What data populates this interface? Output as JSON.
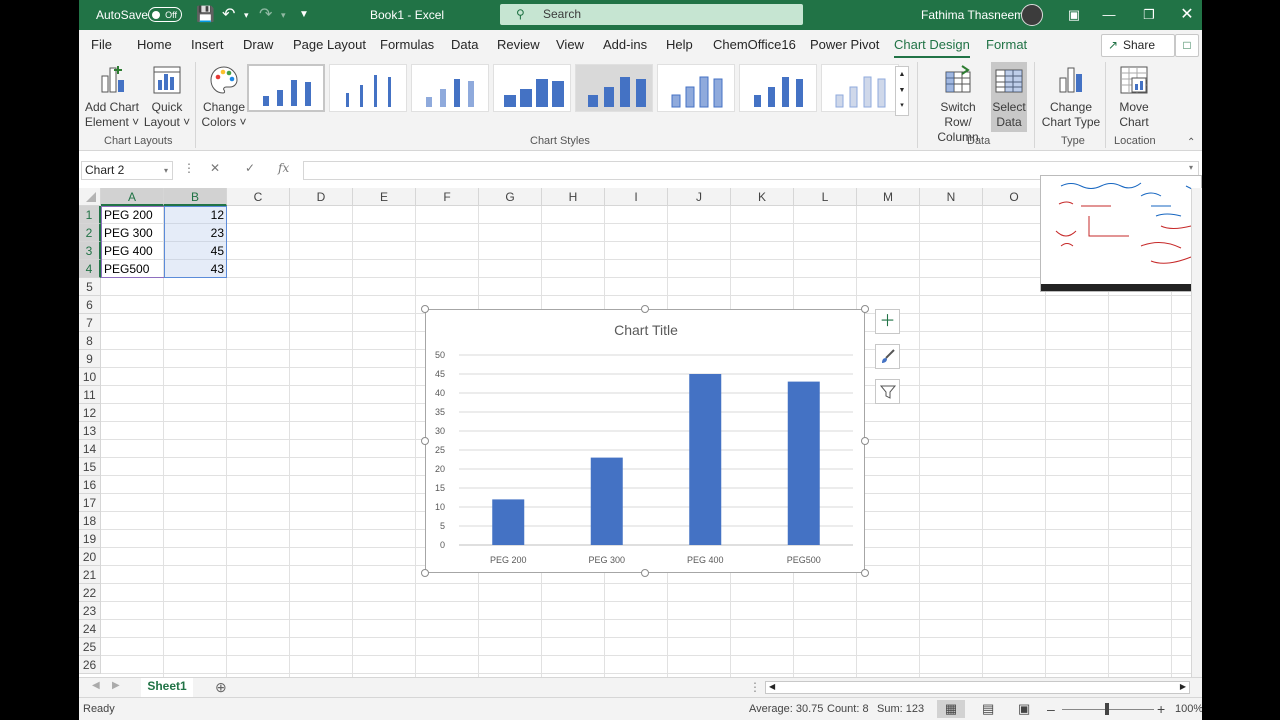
{
  "titlebar": {
    "autosave_label": "AutoSave",
    "autosave_state": "Off",
    "doc_title": "Book1  -  Excel",
    "search_placeholder": "Search",
    "user_name": "Fathima Thasneem"
  },
  "tabs": [
    "File",
    "Home",
    "Insert",
    "Draw",
    "Page Layout",
    "Formulas",
    "Data",
    "Review",
    "View",
    "Add-ins",
    "Help",
    "ChemOffice16",
    "Power Pivot",
    "Chart Design",
    "Format"
  ],
  "active_tab": "Chart Design",
  "share_label": "Share",
  "ribbon": {
    "add_chart_element": [
      "Add Chart",
      "Element ˅"
    ],
    "quick_layout": [
      "Quick",
      "Layout ˅"
    ],
    "change_colors": [
      "Change",
      "Colors ˅"
    ],
    "switch_row_column": [
      "Switch Row/",
      "Column"
    ],
    "select_data": [
      "Select",
      "Data"
    ],
    "change_chart_type": [
      "Change",
      "Chart Type"
    ],
    "move_chart": [
      "Move",
      "Chart"
    ],
    "groups": {
      "chart_layouts": "Chart Layouts",
      "chart_styles": "Chart Styles",
      "data": "Data",
      "type": "Type",
      "location": "Location"
    }
  },
  "formula_bar": {
    "name_box": "Chart 2",
    "cancel": "✕",
    "enter": "✓",
    "fx": "fx",
    "content": ""
  },
  "columns": [
    "A",
    "B",
    "C",
    "D",
    "E",
    "F",
    "G",
    "H",
    "I",
    "J",
    "K",
    "L",
    "M",
    "N",
    "O"
  ],
  "rows": [
    "1",
    "2",
    "3",
    "4",
    "5",
    "6",
    "7",
    "8",
    "9",
    "10",
    "11",
    "12",
    "13",
    "14",
    "15",
    "16",
    "17",
    "18",
    "19",
    "20",
    "21",
    "22",
    "23",
    "24",
    "25",
    "26"
  ],
  "cells": [
    {
      "a": "PEG 200",
      "b": "12"
    },
    {
      "a": "PEG 300",
      "b": "23"
    },
    {
      "a": "PEG 400",
      "b": "45"
    },
    {
      "a": "PEG500",
      "b": "43"
    }
  ],
  "chart_data": {
    "type": "bar",
    "title": "Chart Title",
    "categories": [
      "PEG 200",
      "PEG 300",
      "PEG 400",
      "PEG500"
    ],
    "values": [
      12,
      23,
      45,
      43
    ],
    "ylim": [
      0,
      50
    ],
    "yticks": [
      "0",
      "5",
      "10",
      "15",
      "20",
      "25",
      "30",
      "35",
      "40",
      "45",
      "50"
    ],
    "grid": true,
    "bar_color": "#4472c4"
  },
  "sheet_tab": "Sheet1",
  "status": {
    "ready": "Ready",
    "average": "Average: 30.75",
    "count": "Count: 8",
    "sum": "Sum: 123",
    "zoom": "100%"
  },
  "colors": {
    "excel_green": "#217346",
    "ribbon_bg": "#f3f3f3"
  }
}
